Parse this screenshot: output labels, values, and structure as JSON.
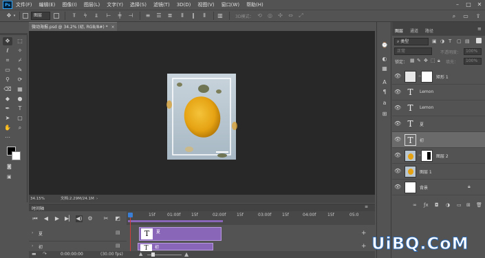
{
  "app": {
    "logo_text": "Ps"
  },
  "menu": {
    "items": [
      "文件(F)",
      "编辑(E)",
      "图像(I)",
      "图层(L)",
      "文字(Y)",
      "选择(S)",
      "滤镜(T)",
      "3D(D)",
      "视图(V)",
      "窗口(W)",
      "帮助(H)"
    ]
  },
  "options_bar": {
    "target_select": "图层",
    "mode_label": "3D模式："
  },
  "document": {
    "tab_title": "微动海报.psd @ 34.2% (初, RGB/8#) *",
    "zoom": "34.15%",
    "doc_info": "文档:2.29M/24.1M"
  },
  "timeline": {
    "title": "时间轴",
    "ruler_labels": [
      "15f",
      "01:00f",
      "15f",
      "02:00f",
      "15f",
      "03:00f",
      "15f",
      "04:00f",
      "15f",
      "05:0"
    ],
    "tracks": [
      {
        "label": "夏",
        "clip_label": "夏"
      },
      {
        "label": "初",
        "clip_label": "初"
      }
    ],
    "timecode": "0:00:00:00",
    "fps": "(30.00 fps)"
  },
  "layers_panel": {
    "tabs": [
      "图层",
      "通道",
      "路径"
    ],
    "filter_kind": "类型",
    "blend_mode": "正常",
    "opacity_label": "不透明度：",
    "opacity_value": "100%",
    "lock_label": "锁定：",
    "fill_label": "填充：",
    "fill_value": "100%",
    "layers": [
      {
        "name": "矩形 1",
        "kind": "shape",
        "selected": false
      },
      {
        "name": "Lemon",
        "kind": "text",
        "selected": false
      },
      {
        "name": "Lemon",
        "kind": "text",
        "selected": false
      },
      {
        "name": "夏",
        "kind": "text",
        "selected": false
      },
      {
        "name": "初",
        "kind": "text",
        "selected": true
      },
      {
        "name": "图层 2",
        "kind": "image-masked",
        "selected": false
      },
      {
        "name": "图层 1",
        "kind": "image",
        "selected": false
      },
      {
        "name": "背景",
        "kind": "background",
        "selected": false
      }
    ]
  },
  "watermark": {
    "text": "UiBQ.CoM"
  },
  "colors": {
    "selected_layer": "#6a6a6a",
    "clip_purple": "#8a66b8",
    "playhead": "#3a7fd5"
  }
}
